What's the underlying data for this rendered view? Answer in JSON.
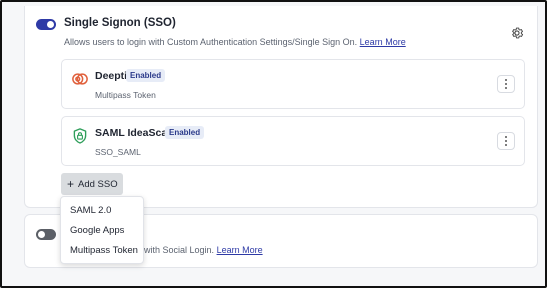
{
  "sso": {
    "title": "Single Signon (SSO)",
    "description": "Allows users to login with Custom Authentication Settings/Single Sign On.",
    "learn_more": "Learn More",
    "enabled": true,
    "providers": [
      {
        "name": "Deepti",
        "status": "Enabled",
        "type": "Multipass Token",
        "icon": "multipass-icon"
      },
      {
        "name": "SAML IdeaScale",
        "status": "Enabled",
        "type": "SSO_SAML",
        "icon": "shield-lock-icon"
      }
    ],
    "add_button": "Add SSO",
    "dropdown": [
      "SAML 2.0",
      "Google Apps",
      "Multipass Token"
    ]
  },
  "social": {
    "enabled": false,
    "description_visible": "with Social Login.",
    "learn_more": "Learn More"
  },
  "colors": {
    "accent": "#2e3aa6",
    "badge_bg": "#e7ecf7",
    "toggle_off": "#5b5f66"
  }
}
